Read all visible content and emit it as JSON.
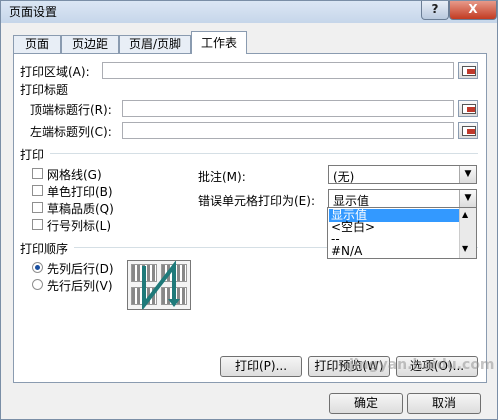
{
  "window": {
    "title": "页面设置",
    "help": "?",
    "close": "X"
  },
  "tabs": [
    "页面",
    "页边距",
    "页眉/页脚",
    "工作表"
  ],
  "print_area": {
    "label": "打印区域(A):",
    "value": ""
  },
  "print_titles": {
    "heading": "打印标题",
    "rows_label": "顶端标题行(R):",
    "cols_label": "左端标题列(C):"
  },
  "print": {
    "heading": "打印",
    "checkboxes": [
      "网格线(G)",
      "单色打印(B)",
      "草稿品质(Q)",
      "行号列标(L)"
    ],
    "comments_label": "批注(M):",
    "comments_value": "(无)",
    "errors_label": "错误单元格打印为(E):",
    "errors_value": "显示值",
    "errors_options": [
      "显示值",
      "<空白>",
      "--",
      "#N/A"
    ]
  },
  "order": {
    "heading": "打印顺序",
    "options": [
      "先列后行(D)",
      "先行后列(V)"
    ],
    "selected": 0
  },
  "buttons": {
    "print": "打印(P)...",
    "preview": "打印预览(W)",
    "options": "选项(O)...",
    "ok": "确定",
    "cancel": "取消"
  },
  "watermark": "jingyan.baidu.com",
  "colors": {
    "selection": "#3399ff",
    "arrow": "#1f7a7a",
    "close": "#c23b22"
  }
}
